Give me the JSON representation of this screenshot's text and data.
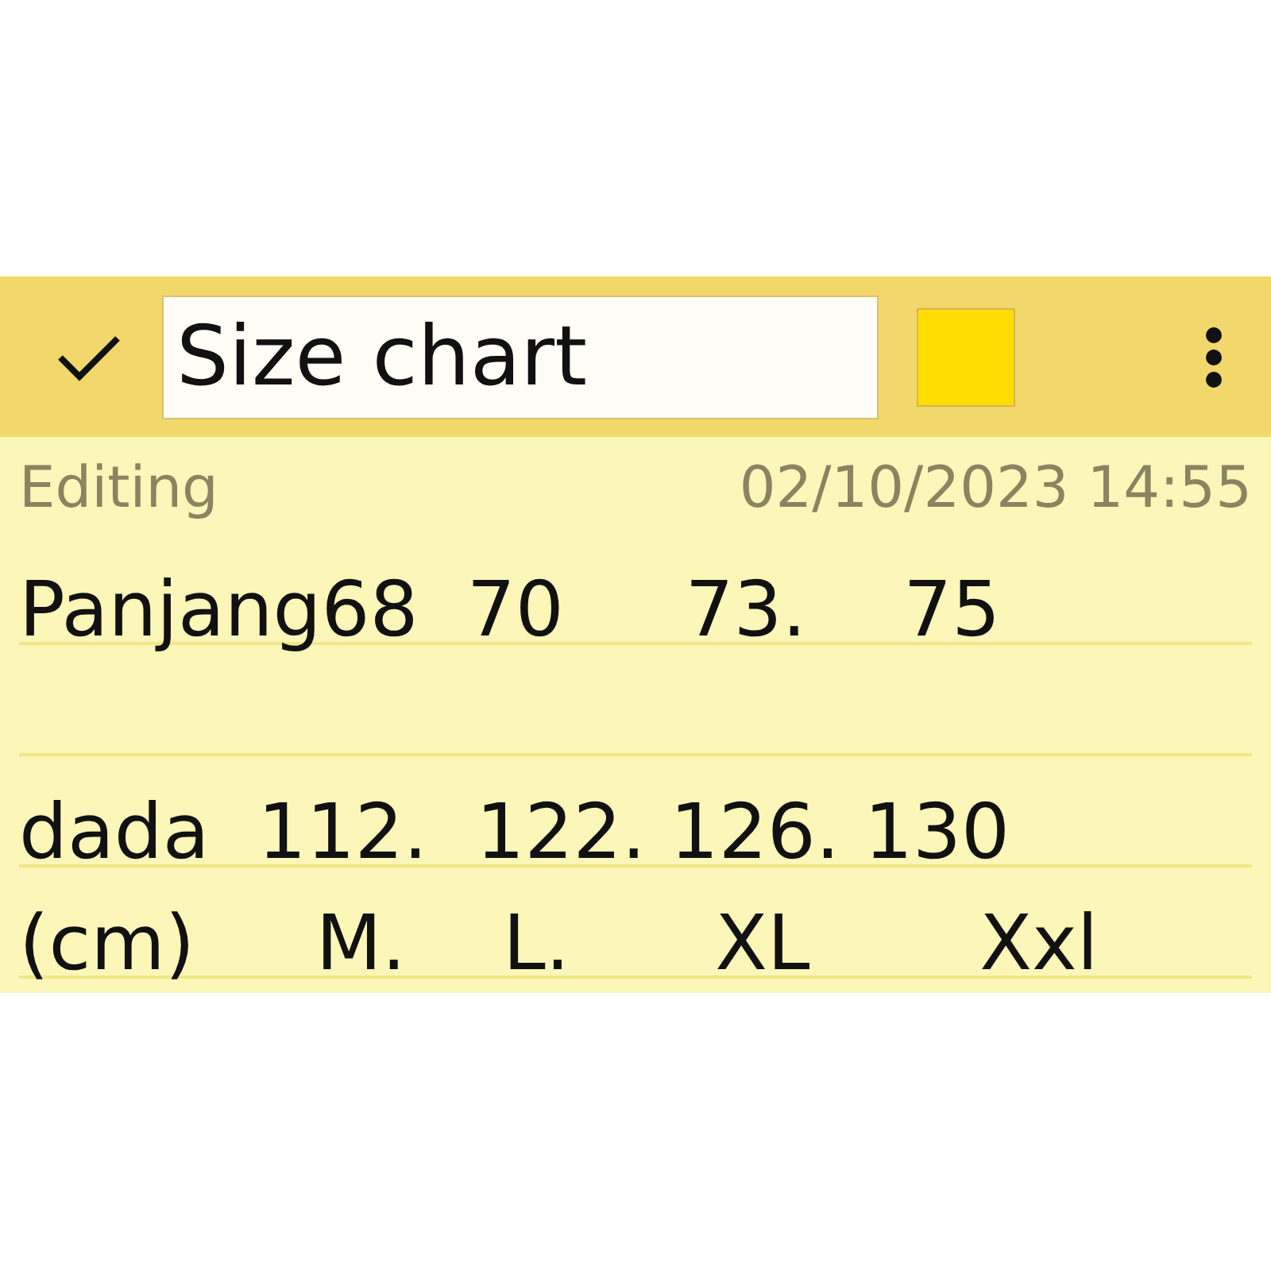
{
  "toolbar": {
    "title_value": "Size chart"
  },
  "status": {
    "mode": "Editing",
    "timestamp": "02/10/2023 14:55"
  },
  "note_lines": [
    {
      "text": "Panjang68  70     73.    75",
      "gap_before": false
    },
    {
      "text": "dada  112.  122. 126. 130",
      "gap_before": true
    },
    {
      "text": "(cm)     M.    L.      XL       Xxl",
      "gap_before": false
    }
  ]
}
